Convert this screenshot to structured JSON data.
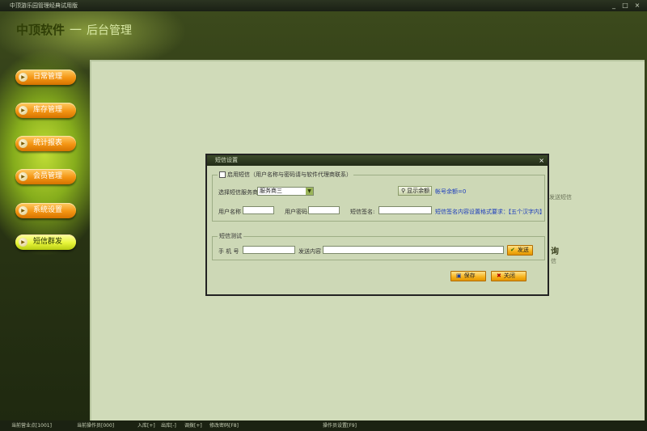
{
  "window": {
    "title": "中顶游乐园管理经典试用版",
    "controls": [
      "_",
      "□",
      "×"
    ]
  },
  "brand": {
    "name": "中顶软件",
    "separator": "一",
    "subtitle": "后台管理"
  },
  "nav": [
    {
      "label": "日常管理"
    },
    {
      "label": "库存管理"
    },
    {
      "label": "统计报表"
    },
    {
      "label": "会员管理"
    },
    {
      "label": "系统设置"
    },
    {
      "label": "短信群发"
    }
  ],
  "background": {
    "text1": "发送短信",
    "text2": "询",
    "text3": "信"
  },
  "dialog": {
    "title": "短信设置",
    "close": "×",
    "group1_legend": "启用短信（用户名称与密码请与软件代理商联系）",
    "provider_label": "选择短信服务商",
    "provider_value": "服务商三",
    "balance_button": "显示余额",
    "balance_text": "帐号余额=0",
    "username_label": "用户名称",
    "password_label": "用户密码",
    "signature_label": "短信签名:",
    "signature_hint": "短信签名内容设置格式要求：",
    "signature_rule": "【五个汉字内】",
    "group2_legend": "短信测试",
    "phone_label": "手 机 号",
    "content_label": "发送内容",
    "send_button": "发送",
    "save_button": "保存",
    "close_button": "关闭",
    "username": "",
    "password": "",
    "signature": "",
    "phone": "",
    "content": ""
  },
  "status": {
    "store": "当前营业点[1001]",
    "operator": "当前操作员[000]",
    "stock_in": "入库[+]",
    "stock_out": "出库[-]",
    "transfer": "调拨[+]",
    "change_password": "修改密码[F8]",
    "operator_settings": "操作员设置[F9]"
  },
  "colors": {
    "nav_orange": "#f49513",
    "nav_active": "#e7f53a",
    "link_blue": "#1b3bbd",
    "dialog_bg": "#cdd8b6"
  }
}
